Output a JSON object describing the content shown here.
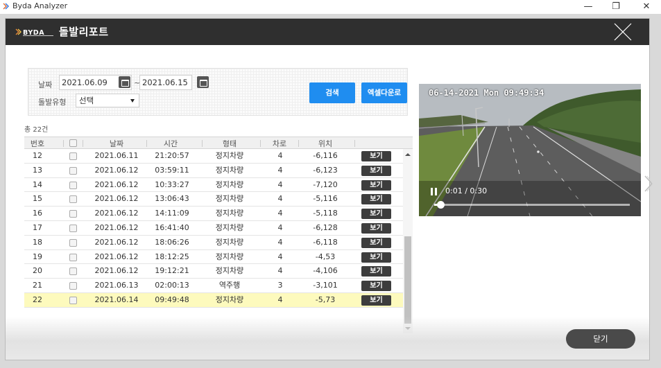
{
  "app": {
    "title": "Byda Analyzer",
    "minimize": "—",
    "restore": "❐",
    "close": "✕"
  },
  "modal": {
    "logo_text": "BYDA",
    "title": "돌발리포트"
  },
  "filters": {
    "date_label": "날짜",
    "date_from": "2021.06.09",
    "date_separator": "~",
    "date_to": "2021.06.15",
    "type_label": "돌발유형",
    "type_selected": "선택",
    "search_label": "검색",
    "excel_label": "엑셀다운로"
  },
  "table": {
    "total": "총 22건",
    "columns": [
      "번호",
      "날짜",
      "시간",
      "형태",
      "차로",
      "위치"
    ],
    "view_label": "보기",
    "rows": [
      {
        "no": "12",
        "date": "2021.06.11",
        "time": "21:20:57",
        "type": "정지차량",
        "lane": "4",
        "loc": "-6,116"
      },
      {
        "no": "13",
        "date": "2021.06.12",
        "time": "03:59:11",
        "type": "정지차량",
        "lane": "4",
        "loc": "-6,123"
      },
      {
        "no": "14",
        "date": "2021.06.12",
        "time": "10:33:27",
        "type": "정지차량",
        "lane": "4",
        "loc": "-7,120"
      },
      {
        "no": "15",
        "date": "2021.06.12",
        "time": "13:06:43",
        "type": "정지차량",
        "lane": "4",
        "loc": "-5,116"
      },
      {
        "no": "16",
        "date": "2021.06.12",
        "time": "14:11:09",
        "type": "정지차량",
        "lane": "4",
        "loc": "-5,118"
      },
      {
        "no": "17",
        "date": "2021.06.12",
        "time": "16:41:40",
        "type": "정지차량",
        "lane": "4",
        "loc": "-6,128"
      },
      {
        "no": "18",
        "date": "2021.06.12",
        "time": "18:06:26",
        "type": "정지차량",
        "lane": "4",
        "loc": "-6,118"
      },
      {
        "no": "19",
        "date": "2021.06.12",
        "time": "18:12:25",
        "type": "정지차량",
        "lane": "4",
        "loc": "-4,53"
      },
      {
        "no": "20",
        "date": "2021.06.12",
        "time": "19:12:21",
        "type": "정지차량",
        "lane": "4",
        "loc": "-4,106"
      },
      {
        "no": "21",
        "date": "2021.06.13",
        "time": "02:00:13",
        "type": "역주행",
        "lane": "3",
        "loc": "-3,101"
      },
      {
        "no": "22",
        "date": "2021.06.14",
        "time": "09:49:48",
        "type": "정지차량",
        "lane": "4",
        "loc": "-5,73",
        "selected": true
      }
    ]
  },
  "video": {
    "timestamp": "06-14-2021 Mon 09:49:34",
    "time_display": "0:01 / 0:30",
    "progress": 0.033
  },
  "footer": {
    "close_label": "닫기"
  }
}
